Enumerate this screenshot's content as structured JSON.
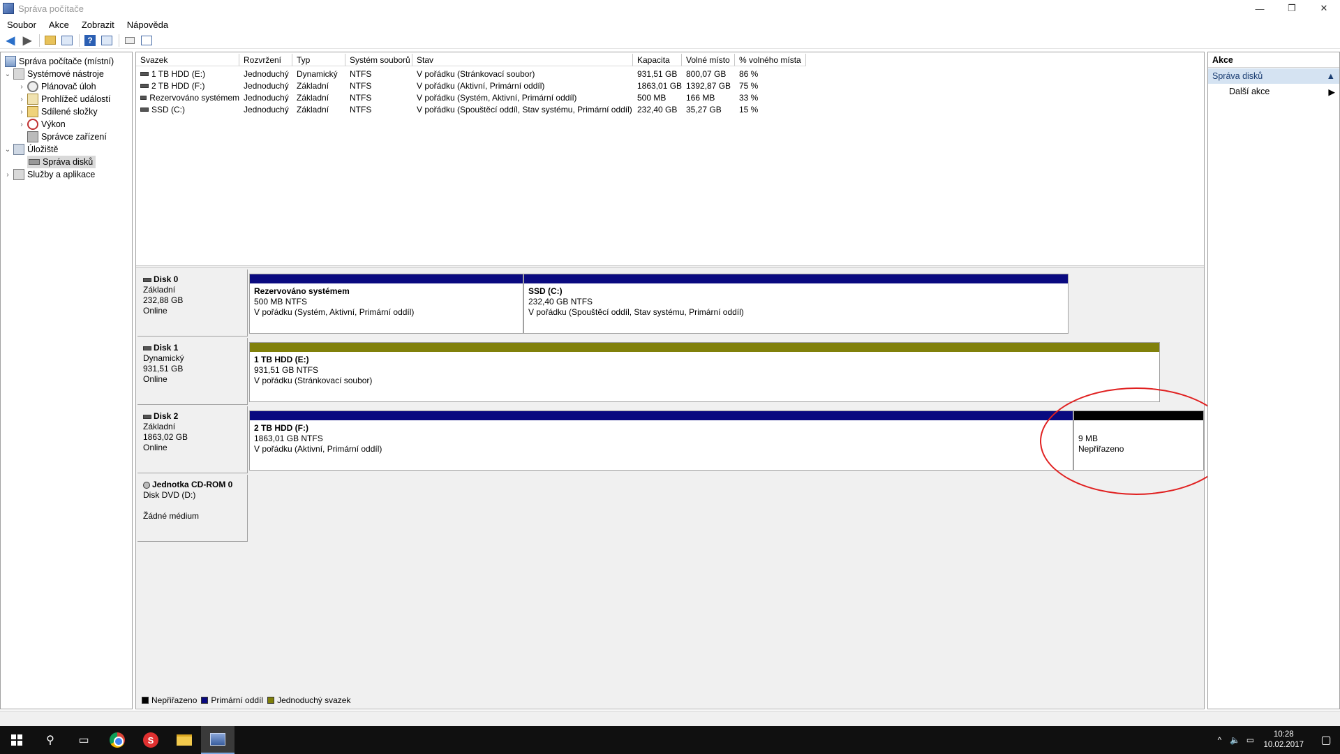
{
  "window": {
    "title": "Správa počítače",
    "controls": {
      "minimize": "—",
      "restore": "❐",
      "close": "✕"
    }
  },
  "menu": [
    "Soubor",
    "Akce",
    "Zobrazit",
    "Nápověda"
  ],
  "tree": {
    "items": [
      {
        "label": "Správa počítače (místní)",
        "icon": "computer-icon"
      },
      {
        "label": "Systémové nástroje",
        "icon": "tools-icon"
      },
      {
        "label": "Plánovač úloh",
        "icon": "clock-icon"
      },
      {
        "label": "Prohlížeč událostí",
        "icon": "event-viewer-icon"
      },
      {
        "label": "Sdílené složky",
        "icon": "shared-folder-icon"
      },
      {
        "label": "Výkon",
        "icon": "performance-icon"
      },
      {
        "label": "Správce zařízení",
        "icon": "device-manager-icon"
      },
      {
        "label": "Úložiště",
        "icon": "storage-icon"
      },
      {
        "label": "Správa disků",
        "icon": "disk-icon"
      },
      {
        "label": "Služby a aplikace",
        "icon": "services-icon"
      }
    ]
  },
  "volume_table": {
    "headers": [
      "Svazek",
      "Rozvržení",
      "Typ",
      "Systém souborů",
      "Stav",
      "Kapacita",
      "Volné místo",
      "% volného místa"
    ],
    "rows": [
      [
        "1 TB HDD (E:)",
        "Jednoduchý",
        "Dynamický",
        "NTFS",
        "V pořádku (Stránkovací soubor)",
        "931,51 GB",
        "800,07 GB",
        "86 %"
      ],
      [
        "2 TB HDD (F:)",
        "Jednoduchý",
        "Základní",
        "NTFS",
        "V pořádku (Aktivní, Primární oddíl)",
        "1863,01 GB",
        "1392,87 GB",
        "75 %"
      ],
      [
        "Rezervováno systémem",
        "Jednoduchý",
        "Základní",
        "NTFS",
        "V pořádku (Systém, Aktivní, Primární oddíl)",
        "500 MB",
        "166 MB",
        "33 %"
      ],
      [
        "SSD (C:)",
        "Jednoduchý",
        "Základní",
        "NTFS",
        "V pořádku (Spouštěcí oddíl, Stav systému, Primární oddíl)",
        "232,40 GB",
        "35,27 GB",
        "15 %"
      ]
    ]
  },
  "disks": [
    {
      "name": "Disk 0",
      "type": "Základní",
      "size": "232,88 GB",
      "status": "Online",
      "partitions": [
        {
          "name": "Rezervováno systémem",
          "size": "500 MB NTFS",
          "status": "V pořádku (Systém, Aktivní, Primární oddíl)",
          "kind": "primary"
        },
        {
          "name": "SSD  (C:)",
          "size": "232,40 GB NTFS",
          "status": "V pořádku (Spouštěcí oddíl, Stav systému, Primární oddíl)",
          "kind": "primary"
        }
      ]
    },
    {
      "name": "Disk 1",
      "type": "Dynamický",
      "size": "931,51 GB",
      "status": "Online",
      "partitions": [
        {
          "name": "1 TB HDD  (E:)",
          "size": "931,51 GB NTFS",
          "status": "V pořádku (Stránkovací soubor)",
          "kind": "simple"
        }
      ]
    },
    {
      "name": "Disk 2",
      "type": "Základní",
      "size": "1863,02 GB",
      "status": "Online",
      "partitions": [
        {
          "name": "2 TB HDD  (F:)",
          "size": "1863,01 GB NTFS",
          "status": "V pořádku (Aktivní, Primární oddíl)",
          "kind": "primary"
        },
        {
          "name": "",
          "size": "9 MB",
          "status": "Nepřiřazeno",
          "kind": "unallocated"
        }
      ]
    },
    {
      "name": "Jednotka CD-ROM 0",
      "type": "Disk DVD (D:)",
      "size": "",
      "status": "Žádné médium",
      "partitions": []
    }
  ],
  "legend": [
    {
      "label": "Nepřiřazeno",
      "color": "#000000"
    },
    {
      "label": "Primární oddíl",
      "color": "#0a0a80"
    },
    {
      "label": "Jednoduchý svazek",
      "color": "#80800a"
    }
  ],
  "actions": {
    "header": "Akce",
    "section": "Správa disků",
    "item": "Další akce"
  },
  "taskbar": {
    "time": "10:28",
    "date": "10.02.2017"
  }
}
